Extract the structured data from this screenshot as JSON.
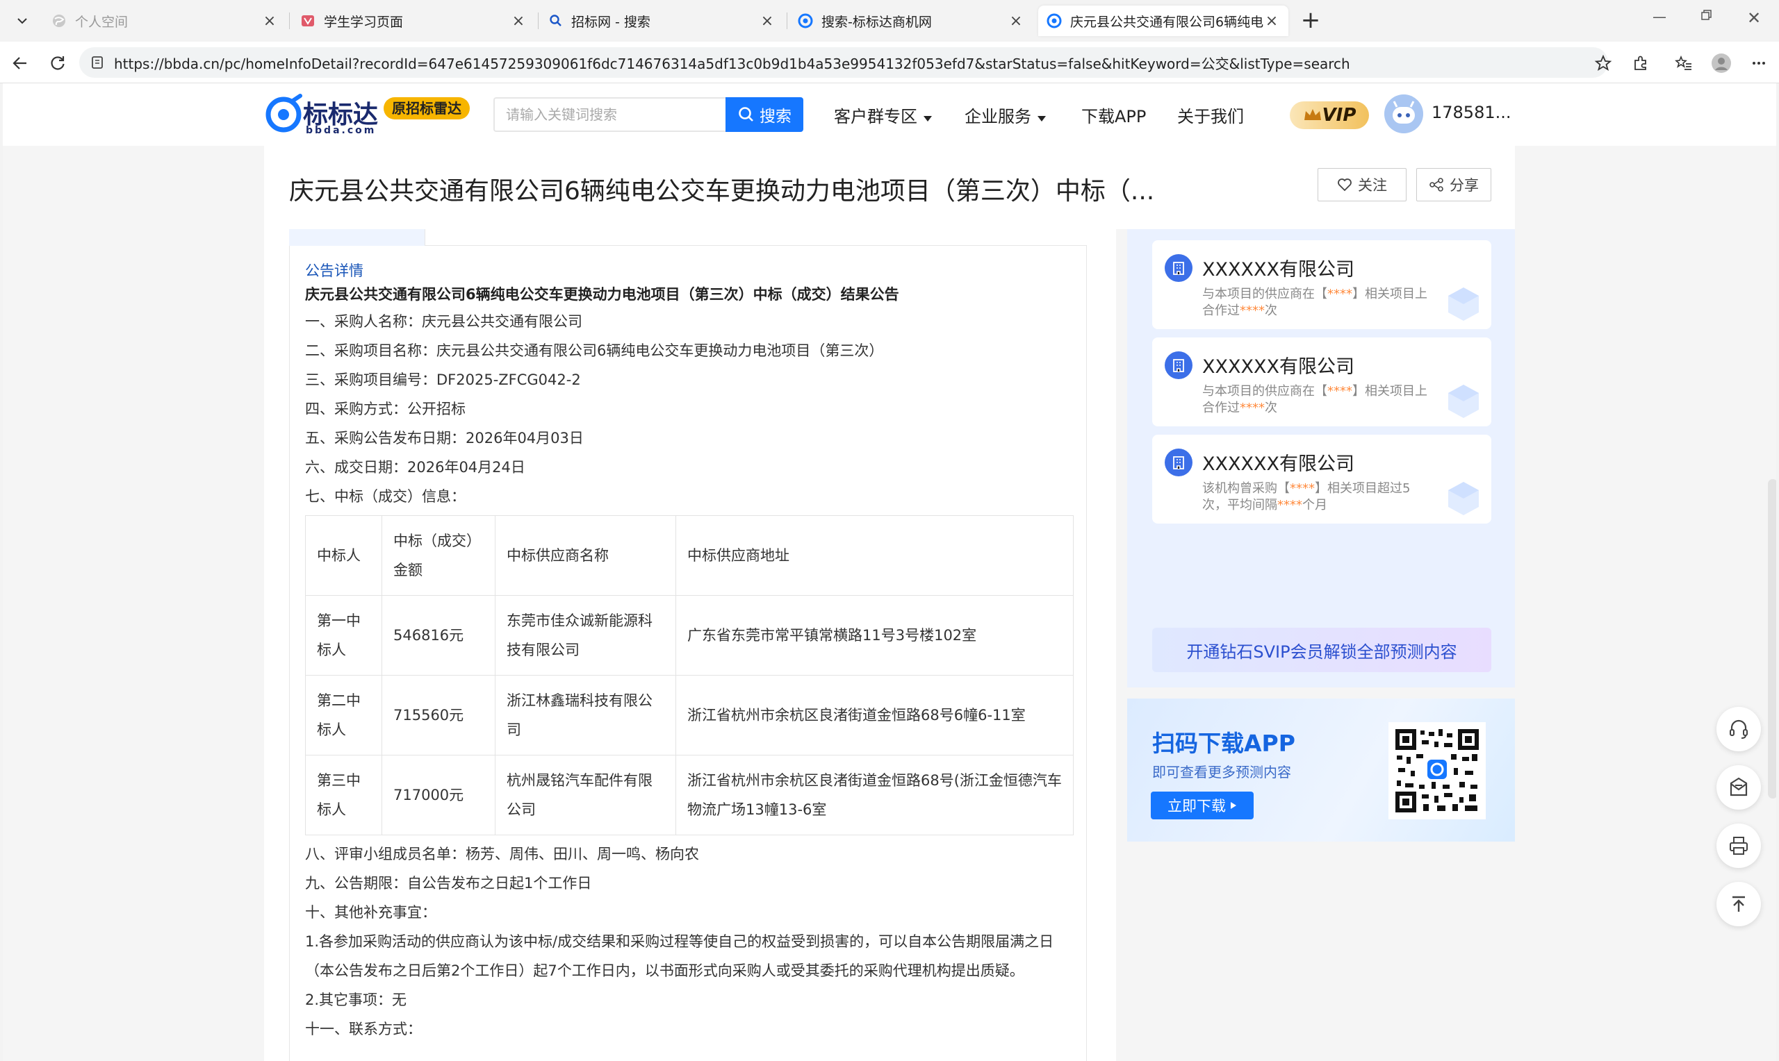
{
  "browser": {
    "tabs": [
      {
        "title": "个人空间",
        "state": "dim"
      },
      {
        "title": "学生学习页面",
        "state": "normal"
      },
      {
        "title": "招标网 - 搜索",
        "state": "normal"
      },
      {
        "title": "搜索-标标达商机网",
        "state": "normal"
      },
      {
        "title": "庆元县公共交通有限公司6辆纯电公",
        "state": "active"
      }
    ],
    "url": "https://bbda.cn/pc/homeInfoDetail?recordId=647e61457259309061f6dc714676314a5df13c0b9d1b4a53e9954132f053efd7&starStatus=false&hitKeyword=公交&listType=search"
  },
  "site": {
    "logo_text": "标标达",
    "logo_sub": "bbda.com",
    "logo_badge": "原招标雷达",
    "search_placeholder": "请输入关键词搜索",
    "search_button": "搜索",
    "nav": [
      "客户群专区",
      "企业服务",
      "下载APP",
      "关于我们"
    ],
    "vip_label": "VIP",
    "username": "178581..."
  },
  "title_card": {
    "title": "庆元县公共交通有限公司6辆纯电公交车更换动力电池项目（第三次）中标（...",
    "follow_label": "关注",
    "share_label": "分享"
  },
  "article": {
    "section_label": "公告详情",
    "heading": "庆元县公共交通有限公司6辆纯电公交车更换动力电池项目（第三次）中标（成交）结果公告",
    "lines_top": [
      "一、采购人名称：庆元县公共交通有限公司",
      "二、采购项目名称：庆元县公共交通有限公司6辆纯电公交车更换动力电池项目（第三次）",
      "三、采购项目编号：DF2025-ZFCG042-2",
      "四、采购方式：公开招标",
      "五、采购公告发布日期：2026年04月03日",
      "六、成交日期：2026年04月24日",
      "七、中标（成交）信息："
    ],
    "table": {
      "headers": [
        "中标人",
        "中标（成交）金额",
        "中标供应商名称",
        "中标供应商地址"
      ],
      "rows": [
        [
          "第一中标人",
          "546816元",
          "东莞市佳众诚新能源科技有限公司",
          "广东省东莞市常平镇常横路11号3号楼102室"
        ],
        [
          "第二中标人",
          "715560元",
          "浙江林鑫瑞科技有限公司",
          "浙江省杭州市余杭区良渚街道金恒路68号6幢6-11室"
        ],
        [
          "第三中标人",
          "717000元",
          "杭州晟铭汽车配件有限公司",
          "浙江省杭州市余杭区良渚街道金恒路68号(浙江金恒德汽车物流广场13幢13-6室"
        ]
      ]
    },
    "lines_bottom": [
      "八、评审小组成员名单：杨芳、周伟、田川、周一鸣、杨向农",
      "九、公告期限：自公告发布之日起1个工作日",
      "十、其他补充事宜：",
      "1.各参加采购活动的供应商认为该中标/成交结果和采购过程等使自己的权益受到损害的，可以自本公告期限届满之日",
      "（本公告发布之日后第2个工作日）起7个工作日内，以书面形式向采购人或受其委托的采购代理机构提出质疑。",
      "2.其它事项：无",
      "十一、联系方式："
    ]
  },
  "right": {
    "suppliers": [
      {
        "name": "XXXXXX有限公司",
        "desc_a": "与本项目的供应商在【",
        "mask": "****",
        "desc_b": "】相关项目上合作过",
        "mask2": "****",
        "desc_c": "次"
      },
      {
        "name": "XXXXXX有限公司",
        "desc_a": "与本项目的供应商在【",
        "mask": "****",
        "desc_b": "】相关项目上合作过",
        "mask2": "****",
        "desc_c": "次"
      },
      {
        "name": "XXXXXX有限公司",
        "desc_a": "该机构曾采购【",
        "mask": "****",
        "desc_b": "】相关项目超过5次，平均间隔",
        "mask2": "****",
        "desc_c": "个月"
      }
    ],
    "svip_button": "开通钻石SVIP会员解锁全部预测内容",
    "app_banner": {
      "title": "扫码下载APP",
      "subtitle": "即可查看更多预测内容",
      "button": "立即下载"
    }
  },
  "colors": {
    "brand_blue": "#1677ff",
    "badge_yellow": "#f7b500",
    "mask_orange": "#ff8a3d"
  }
}
